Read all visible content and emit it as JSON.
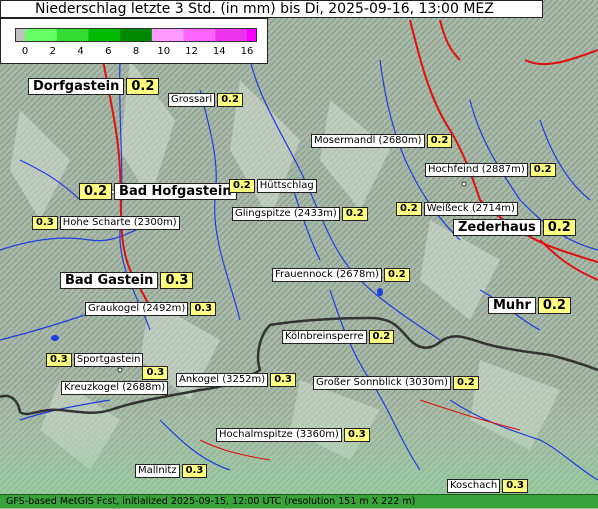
{
  "title": "Niederschlag letzte 3 Std. (in mm) bis Di, 2025-09-16, 13:00 MEZ",
  "legend": {
    "ticks": [
      "0",
      "2",
      "4",
      "6",
      "8",
      "10",
      "12",
      "14",
      "16"
    ],
    "colors": [
      "#c0c0c0",
      "#66ff66",
      "#33dd33",
      "#00bb00",
      "#008800",
      "#ff99ff",
      "#ff66ff",
      "#ee33ee",
      "#ff00ff"
    ]
  },
  "places": [
    {
      "name": "Dorfgastein",
      "value": "0.2"
    },
    {
      "name": "Grossarl",
      "value": "0.2"
    },
    {
      "name": "Mosermandl (2680m)",
      "value": "0.2"
    },
    {
      "name": "Hochfeind (2887m)",
      "value": "0.2"
    },
    {
      "name": "Bad Hofgastein",
      "value": "0.2"
    },
    {
      "name": "Hüttschlag",
      "value": "0.2"
    },
    {
      "name": "Weißeck (2714m)",
      "value": "0.2"
    },
    {
      "name": "Hohe Scharte (2300m)",
      "value": "0.3"
    },
    {
      "name": "Glingspitze (2433m)",
      "value": "0.2"
    },
    {
      "name": "Zederhaus",
      "value": "0.2"
    },
    {
      "name": "Frauennock (2678m)",
      "value": "0.2"
    },
    {
      "name": "Bad Gastein",
      "value": "0.3"
    },
    {
      "name": "Graukogel (2492m)",
      "value": "0.3"
    },
    {
      "name": "Muhr",
      "value": "0.2"
    },
    {
      "name": "Kölnbreinsperre",
      "value": "0.2"
    },
    {
      "name": "Sportgastein",
      "value": "0.3"
    },
    {
      "name": "Kreuzkogel (2688m)",
      "value": "0.3"
    },
    {
      "name": "Ankogel (3252m)",
      "value": "0.3"
    },
    {
      "name": "Großer Sonnblick (3030m)",
      "value": "0.2"
    },
    {
      "name": "Hochalmspitze (3360m)",
      "value": "0.3"
    },
    {
      "name": "Mallnitz",
      "value": "0.3"
    },
    {
      "name": "Koschach",
      "value": "0.3"
    }
  ],
  "footer": "GFS-based MetGIS Fcst, initialized 2025-09-15, 12:00 UTC (resolution 151 m X 222 m)"
}
